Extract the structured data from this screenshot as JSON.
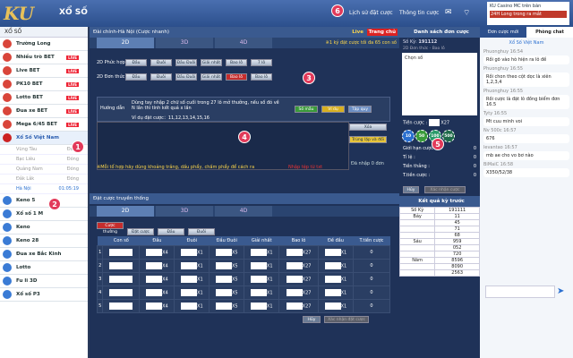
{
  "header": {
    "title": "XỔ SỐ",
    "history_link": "Lịch sử đặt cược",
    "info_link": "Thông tin cược",
    "promo_line1": "KU Casino MC trên bàn",
    "promo_line2": "24H Long trong ra mắt"
  },
  "sidebar": {
    "header": "XỔ SỐ",
    "items": [
      {
        "label": "Trường Long",
        "live": ""
      },
      {
        "label": "Nhiều trò BET",
        "live": "LIVE"
      },
      {
        "label": "Live BET",
        "live": "LIVE"
      },
      {
        "label": "PK10 BET",
        "live": "LIVE"
      },
      {
        "label": "Lotto BET",
        "live": "LIVE"
      },
      {
        "label": "Đua xe BET",
        "live": "LIVE"
      },
      {
        "label": "Mega 6/45 BET",
        "live": "LIVE"
      }
    ],
    "active": "Xổ Số Việt Nam",
    "subitems": [
      {
        "label": "Vũng Tàu",
        "right": "Đóng"
      },
      {
        "label": "Bạc Liêu",
        "right": "Đóng"
      },
      {
        "label": "Quảng Nam",
        "right": "Đóng"
      },
      {
        "label": "Đắk Lắk",
        "right": "Đóng"
      },
      {
        "label": "Hà Nội",
        "right": "01:05:19"
      }
    ],
    "items2": [
      "Keno 5",
      "Xổ số 1 M",
      "Keno",
      "Keno 28",
      "Đua xe Bắc Kinh",
      "Lotto",
      "Fu li 3D",
      "Xổ số P3"
    ]
  },
  "main": {
    "panel_title": "Đài chính-Hà Nội (Cược nhanh)",
    "live": "Live",
    "home": "Trang chủ",
    "tabs": [
      "2D",
      "3D",
      "4D"
    ],
    "note": "※1 ký đặt cược tối đa 65 con số",
    "row1_label": "2D Phức hợp",
    "row2_label": "2D Đơn thức",
    "row1_btns": [
      "Đầu",
      "Đuôi",
      "Đầu Đuôi",
      "Giải nhất",
      "Bao lô",
      "7 lô"
    ],
    "row2_btns": [
      "Đầu",
      "Đuôi",
      "Đầu Đuôi",
      "Giải nhất",
      "Bao lô",
      "Bao lô"
    ],
    "help_label": "Hướng dẫn",
    "help_text": "Dùng tay nhập 2 chữ số cuối trong 27 lô mở thưởng, nếu số đó về N lần thì tính kết quả x lần",
    "help_example": "Ví dụ đặt cược：11,12,13,14,15,16",
    "help_buttons": [
      "Số mẫu",
      "Ví dụ",
      "Tập quy"
    ],
    "side_btns": [
      "Xóa",
      "Trùng lặp và đổi lại"
    ],
    "footer_note": "※Mỗi tổ hợp hãy dùng khoảng trắng, dấu phẩy, chấm phẩy để cách ra",
    "import_link": "Nhập tệp từ txt",
    "entered": "Đã nhập 0 đơn",
    "section2_title": "Đặt cược truyền thống",
    "tabs2": [
      "2D",
      "3D",
      "4D"
    ],
    "trad_btns": [
      "Cược thường",
      "Đặt cược",
      "Đầu",
      "Đuôi"
    ],
    "table_headers": [
      "Con số",
      "Đầu",
      "Đuôi",
      "Đầu Đuôi",
      "Giải nhất",
      "Bao lô",
      "Đề đầu",
      "T.tiền cược"
    ],
    "mult": [
      "X4",
      "X1",
      "X5",
      "X1",
      "X27",
      "X1"
    ],
    "rows": [
      "1",
      "2",
      "3",
      "4",
      "5"
    ],
    "row_total": "0",
    "cancel": "Hủy",
    "confirm": "Xác nhận đặt cược"
  },
  "bet_panel": {
    "title": "Danh sách đơn cược",
    "ky_label": "Số Kỳ:",
    "ky": "191112",
    "sub": "2D Đơn thức - Bao lô",
    "choose": "Chọn số",
    "multiplier": "X27",
    "rows": [
      {
        "l": "Giới hạn cược :",
        "v": "0"
      },
      {
        "l": "Tỉ lệ :",
        "v": "0"
      },
      {
        "l": "Tiền thắng :",
        "v": "0"
      },
      {
        "l": "T.tiền cược :",
        "v": "0"
      }
    ],
    "chips": [
      "10",
      "50",
      "100",
      "500"
    ],
    "cancel": "Hủy",
    "confirm": "Xác nhận cược",
    "results_title": "Kết quả kỳ trước",
    "res_head": [
      "Số Kỳ",
      "191111"
    ],
    "results": [
      [
        "Bảy",
        "11"
      ],
      [
        "",
        "45"
      ],
      [
        "",
        "71"
      ],
      [
        "",
        "68"
      ],
      [
        "Sáu",
        "959"
      ],
      [
        "",
        "052"
      ],
      [
        "",
        "720"
      ],
      [
        "Năm",
        "8596"
      ],
      [
        "",
        "8090"
      ],
      [
        "",
        "2563"
      ]
    ]
  },
  "chat": {
    "tabs": [
      "Đơn cược mới",
      "Phòng chat"
    ],
    "room": "Xổ Số Việt Nam",
    "messages": [
      {
        "n": "Phuonghuy",
        "t": "16:54",
        "m": "Rồi gõ vào hò hiện ra lô đề"
      },
      {
        "n": "Phuonghuy",
        "t": "16:55",
        "m": "Rồi chon theo cột dọc là xiên 1,2,3,4"
      },
      {
        "n": "Phuonghuy",
        "t": "16:55",
        "m": "Rồi cược là đặt lô đồng biểm đơn 16.5"
      },
      {
        "n": "Tyty",
        "t": "16:55",
        "m": "Mt cuu minh voi"
      },
      {
        "n": "Nv 500c",
        "t": "16:57",
        "m": "676"
      },
      {
        "n": "levantao",
        "t": "16:57",
        "m": "mb ae cho vo bơ nào"
      },
      {
        "n": "BiMaiC",
        "t": "16:58",
        "m": "X350/52/38"
      }
    ]
  }
}
